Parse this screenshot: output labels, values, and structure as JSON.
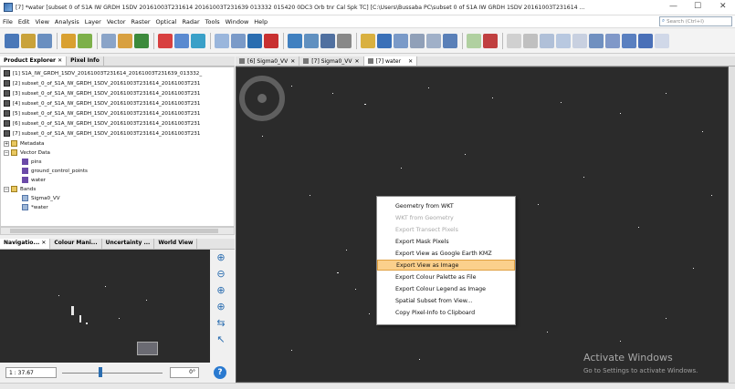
{
  "window": {
    "title": "[7] *water  [subset 0 of S1A IW GRDH 1SDV 20161003T231614 20161003T231639 013332 015420 0DC3 Orb tnr Cal Spk TC]  [C:\\Users\\Bussaba PC\\subset 0 of S1A IW GRDH 1SDV 20161003T231614 ...",
    "minimize": "—",
    "maximize": "☐",
    "close": "✕"
  },
  "menu": [
    "File",
    "Edit",
    "View",
    "Analysis",
    "Layer",
    "Vector",
    "Raster",
    "Optical",
    "Radar",
    "Tools",
    "Window",
    "Help"
  ],
  "search": {
    "placeholder": "Search (Ctrl+I)"
  },
  "product_explorer": {
    "tabs": [
      "Product Explorer",
      "Pixel Info"
    ],
    "close_glyph": "✕",
    "products": [
      "[1] S1A_IW_GRDH_1SDV_20161003T231614_20161003T231639_013332_",
      "[2] subset_0_of_S1A_IW_GRDH_1SDV_20161003T231614_20161003T231",
      "[3] subset_0_of_S1A_IW_GRDH_1SDV_20161003T231614_20161003T231",
      "[4] subset_0_of_S1A_IW_GRDH_1SDV_20161003T231614_20161003T231",
      "[5] subset_0_of_S1A_IW_GRDH_1SDV_20161003T231614_20161003T231",
      "[6] subset_0_of_S1A_IW_GRDH_1SDV_20161003T231614_20161003T231",
      "[7] subset_0_of_S1A_IW_GRDH_1SDV_20161003T231614_20161003T231"
    ],
    "children": {
      "metadata": "Metadata",
      "vector_data": "Vector Data",
      "vectors": [
        "pins",
        "ground_control_points",
        "water"
      ],
      "bands": "Bands",
      "band_items": [
        "Sigma0_VV",
        "*water"
      ]
    }
  },
  "navigation": {
    "tabs": [
      "Navigatio...",
      "Colour Mani...",
      "Uncertainty ...",
      "World View"
    ],
    "zoom": "1 : 37.67",
    "angle": "0°",
    "help": "?"
  },
  "image_tabs": [
    "[6] Sigma0_VV",
    "[7] Sigma0_VV",
    "[7] water"
  ],
  "context_menu": {
    "items": [
      {
        "label": "Geometry from WKT",
        "state": "enabled"
      },
      {
        "label": "WKT from Geometry",
        "state": "disabled"
      },
      {
        "label": "Export Transect Pixels",
        "state": "disabled"
      },
      {
        "label": "Export Mask Pixels",
        "state": "enabled"
      },
      {
        "label": "Export View as Google Earth KMZ",
        "state": "enabled"
      },
      {
        "label": "Export View as Image",
        "state": "selected"
      },
      {
        "label": "Export Colour Palette as File",
        "state": "enabled"
      },
      {
        "label": "Export Colour Legend as Image",
        "state": "enabled"
      },
      {
        "label": "Spatial Subset from View...",
        "state": "enabled"
      },
      {
        "label": "Copy Pixel-Info to Clipboard",
        "state": "enabled"
      }
    ]
  },
  "watermark": {
    "line1": "Activate Windows",
    "line2": "Go to Settings to activate Windows."
  },
  "colors": {
    "image_bg": "#2b2b2b",
    "selected_item": "#fbd08c",
    "accent": "#2a6db0"
  }
}
